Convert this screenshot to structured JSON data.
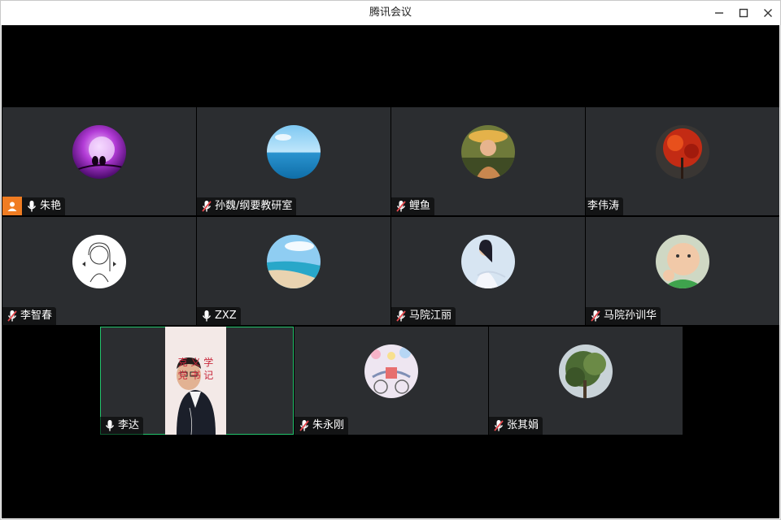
{
  "window": {
    "title": "腾讯会议"
  },
  "participants": [
    {
      "name": "朱艳",
      "mic": "on",
      "host": true,
      "avatar": "purple-moon-cats"
    },
    {
      "name": "孙魏/纲要教研室",
      "mic": "muted",
      "host": false,
      "avatar": "blue-sea"
    },
    {
      "name": "鲤鱼",
      "mic": "muted",
      "host": false,
      "avatar": "girl-sun-hat"
    },
    {
      "name": "李伟涛",
      "mic": "none",
      "host": false,
      "avatar": "red-leaves"
    },
    {
      "name": "李智春",
      "mic": "muted",
      "host": false,
      "avatar": "line-drawing-girl"
    },
    {
      "name": "ZXZ",
      "mic": "on",
      "host": false,
      "avatar": "beach"
    },
    {
      "name": "马院江丽",
      "mic": "muted",
      "host": false,
      "avatar": "woman-white-dress"
    },
    {
      "name": "马院孙训华",
      "mic": "muted",
      "host": false,
      "avatar": "baby-fist"
    },
    {
      "name": "李达",
      "mic": "on",
      "host": false,
      "video": true,
      "speaking": true,
      "video_text": {
        "line1": "克 义 学",
        "line2": "党 书 记"
      }
    },
    {
      "name": "朱永刚",
      "mic": "muted",
      "host": false,
      "avatar": "illustration-cyclist"
    },
    {
      "name": "张其娟",
      "mic": "muted",
      "host": false,
      "avatar": "green-tree"
    }
  ],
  "colors": {
    "tile_bg": "#2b2d30",
    "host_badge": "#f07c22",
    "speaking_border": "#22c36b",
    "mute_red": "#e5484d"
  }
}
